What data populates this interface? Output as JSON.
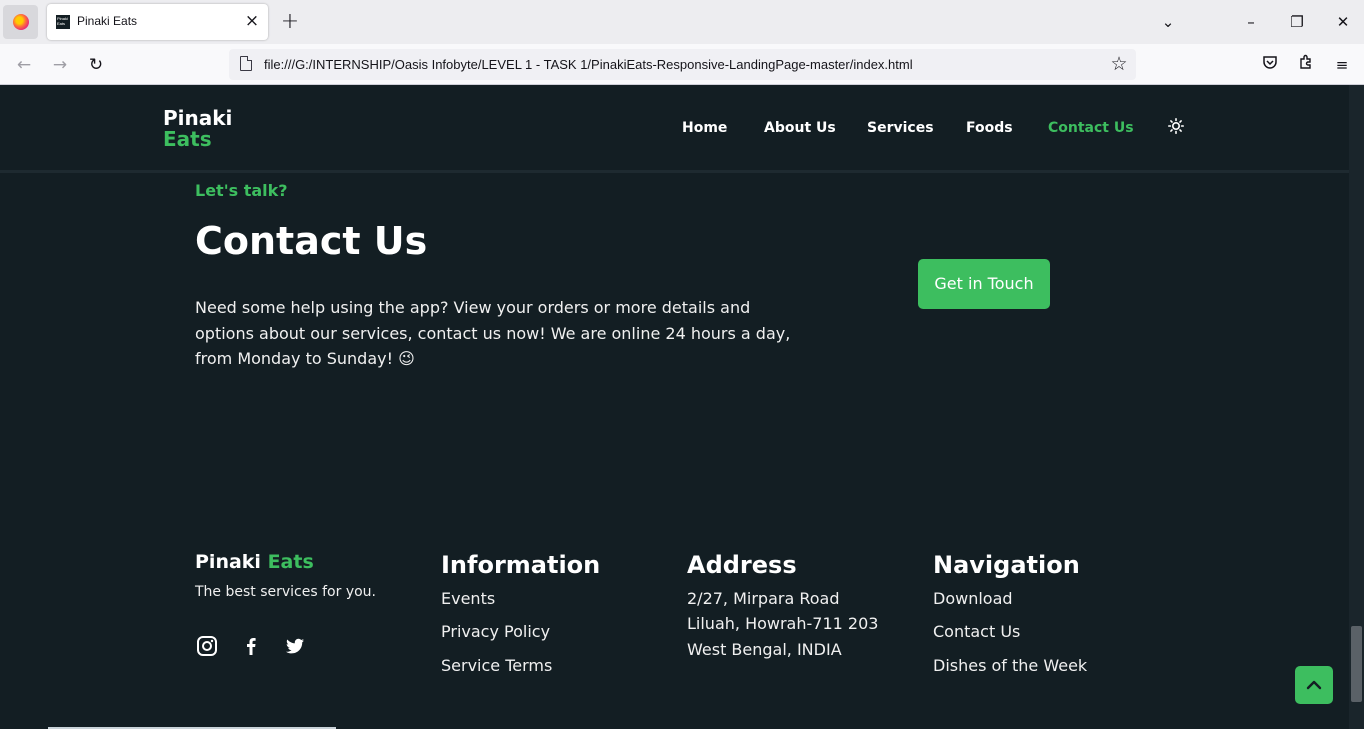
{
  "browser": {
    "tab_title": "Pinaki Eats",
    "tab_favicon_text": "Pinaki Eats",
    "url": "file:///G:/INTERNSHIP/Oasis Infobyte/LEVEL 1 - TASK 1/PinakiEats-Responsive-LandingPage-master/index.html"
  },
  "header": {
    "logo_line1": "Pinaki",
    "logo_line2": "Eats",
    "nav": [
      "Home",
      "About Us",
      "Services",
      "Foods",
      "Contact Us"
    ],
    "active_nav": "Contact Us",
    "theme_icon": "sun-icon"
  },
  "contact": {
    "eyebrow": "Let's talk?",
    "title": "Contact Us",
    "text": "Need some help using the app? View your orders or more details and options about our services, contact us now! We are online 24 hours a day, from Monday to Sunday! 😉",
    "button": "Get in Touch"
  },
  "footer": {
    "brand_1": "Pinaki",
    "brand_2": "Eats",
    "tagline": "The best services for you.",
    "social": [
      "instagram-icon",
      "facebook-icon",
      "twitter-icon"
    ],
    "information": {
      "heading": "Information",
      "links": [
        "Events",
        "Privacy Policy",
        "Service Terms"
      ]
    },
    "address": {
      "heading": "Address",
      "lines": [
        "2/27, Mirpara Road",
        "Liluah, Howrah-711 203",
        "West Bengal, INDIA"
      ]
    },
    "navigation": {
      "heading": "Navigation",
      "links": [
        "Download",
        "Contact Us",
        "Dishes of the Week"
      ]
    }
  },
  "colors": {
    "accent": "#3dbe5f",
    "background": "#131e23"
  }
}
